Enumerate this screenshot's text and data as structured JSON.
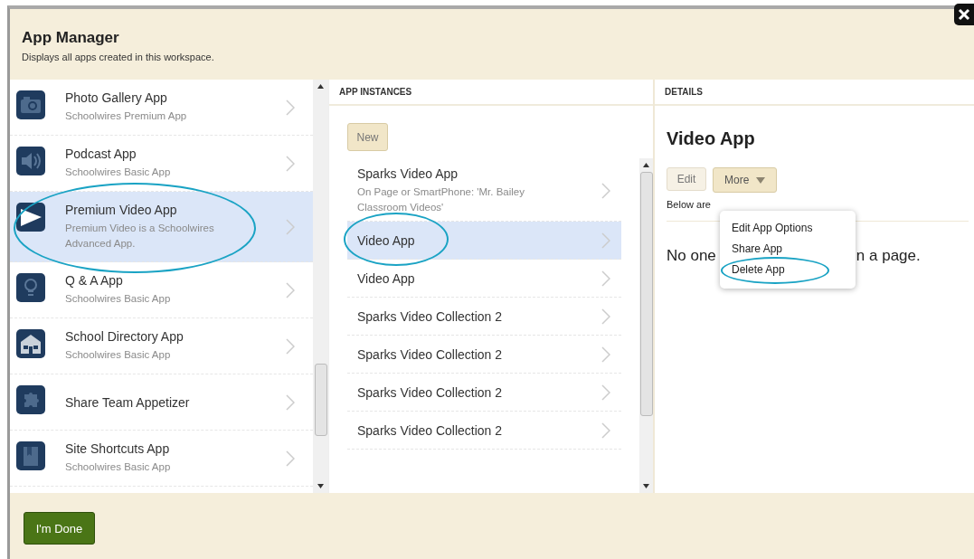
{
  "dialog": {
    "title": "App Manager",
    "subtitle": "Displays all apps created in this workspace."
  },
  "apps": [
    {
      "name": "Photo Gallery App",
      "description": "Schoolwires Premium App",
      "selected": false
    },
    {
      "name": "Podcast App",
      "description": "Schoolwires Basic App",
      "selected": false
    },
    {
      "name": "Premium Video App",
      "description": "Premium Video is a Schoolwires Advanced App.",
      "selected": true
    },
    {
      "name": "Q & A App",
      "description": "Schoolwires Basic App",
      "selected": false
    },
    {
      "name": "School Directory App",
      "description": "Schoolwires Basic App",
      "selected": false
    },
    {
      "name": "Share Team Appetizer",
      "selected": false
    },
    {
      "name": "Site Shortcuts App",
      "description": "Schoolwires Basic App",
      "selected": false
    }
  ],
  "instances": {
    "header": "APP INSTANCES",
    "new_button": "New",
    "items": [
      {
        "name": "Sparks Video App",
        "description": "On Page or SmartPhone: 'Mr. Bailey Classroom Videos'",
        "selected": false
      },
      {
        "name": "Video App",
        "selected": true
      },
      {
        "name": "Video App",
        "selected": false
      },
      {
        "name": "Sparks Video Collection 2",
        "selected": false
      },
      {
        "name": "Sparks Video Collection 2",
        "selected": false
      },
      {
        "name": "Sparks Video Collection 2",
        "selected": false
      },
      {
        "name": "Sparks Video Collection 2",
        "selected": false
      }
    ]
  },
  "details": {
    "header": "DETAILS",
    "title": "Video App",
    "edit_button": "Edit",
    "more_button": "More",
    "pages_note_visible": "Below are",
    "usage_text_visible": [
      "No one",
      "n a page."
    ]
  },
  "more_menu": {
    "items": [
      {
        "label": "Edit App Options",
        "highlighted": false
      },
      {
        "label": "Share App",
        "highlighted": false
      },
      {
        "label": "Delete App",
        "highlighted": true
      }
    ]
  },
  "footer": {
    "done_button": "I'm Done"
  }
}
